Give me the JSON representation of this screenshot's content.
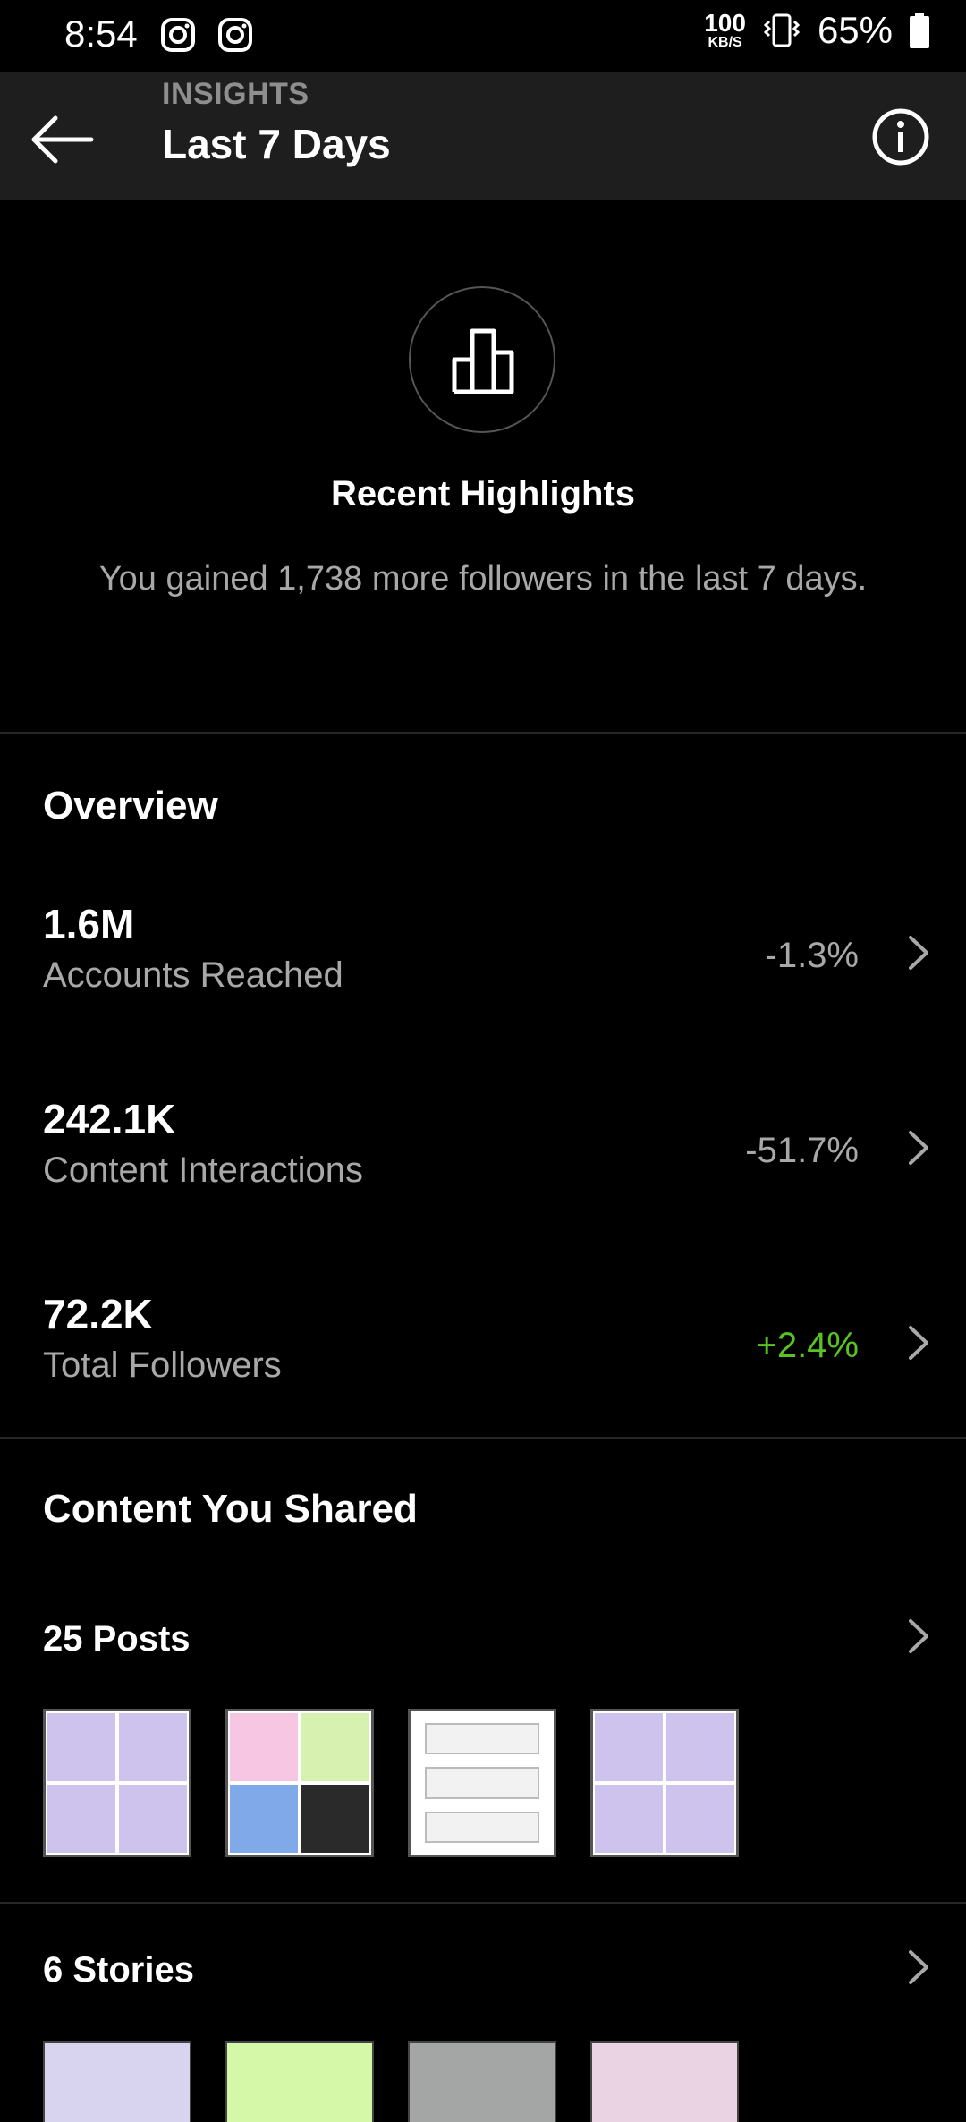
{
  "status_bar": {
    "time": "8:54",
    "net_speed": "100",
    "net_unit": "KB/S",
    "battery": "65%"
  },
  "header": {
    "subtitle": "INSIGHTS",
    "title": "Last 7 Days"
  },
  "highlights": {
    "title": "Recent Highlights",
    "text": "You gained 1,738 more followers in the last 7 days."
  },
  "overview": {
    "title": "Overview",
    "metrics": [
      {
        "value": "1.6M",
        "label": "Accounts Reached",
        "change": "-1.3%"
      },
      {
        "value": "242.1K",
        "label": "Content Interactions",
        "change": "-51.7%"
      },
      {
        "value": "72.2K",
        "label": "Total Followers",
        "change": "+2.4%"
      }
    ]
  },
  "content": {
    "title": "Content You Shared",
    "posts_label": "25 Posts",
    "stories_label": "6 Stories"
  },
  "colors": {
    "positive": "#58c322",
    "muted": "#a8a8a8",
    "story_thumbs": [
      "#d8d4f0",
      "#d4f7a8",
      "#a3a6a4",
      "#ead3e3"
    ]
  }
}
